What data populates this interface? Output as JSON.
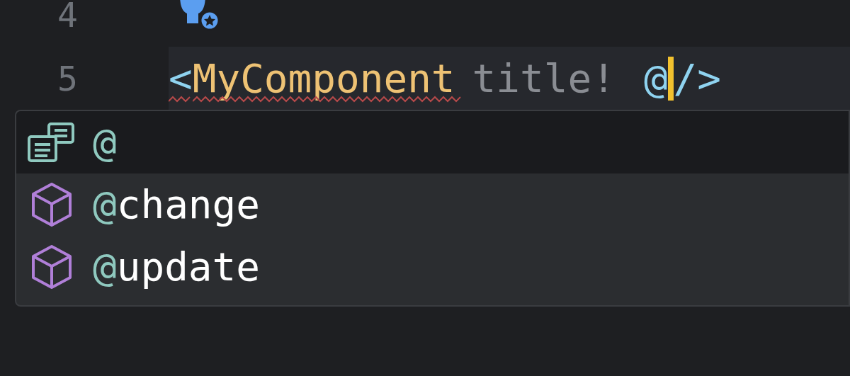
{
  "editor": {
    "lines": [
      {
        "number": "4",
        "current": false,
        "tokens": [
          {
            "kind": "bulb"
          }
        ]
      },
      {
        "number": "5",
        "current": true,
        "tokens": [
          {
            "kind": "bracket",
            "text": "<"
          },
          {
            "kind": "tag",
            "text": "MyComponent"
          },
          {
            "kind": "attr",
            "text": "title!"
          },
          {
            "kind": "event",
            "text": "@"
          },
          {
            "kind": "caret"
          },
          {
            "kind": "bracket",
            "text": "/>"
          }
        ]
      }
    ]
  },
  "completion": {
    "items": [
      {
        "kind": "template",
        "match": "@",
        "selected": true
      },
      {
        "kind": "property",
        "match": "@",
        "rest": "change",
        "selected": false
      },
      {
        "kind": "property",
        "match": "@",
        "rest": "update",
        "selected": false
      }
    ]
  }
}
